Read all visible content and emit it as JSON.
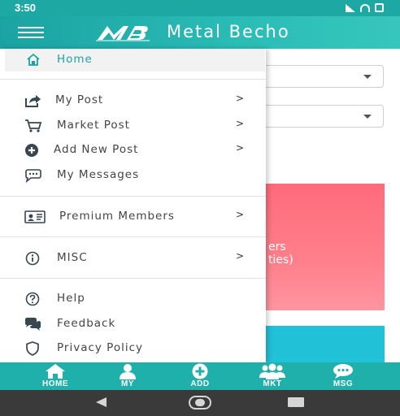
{
  "status": {
    "time": "3:50"
  },
  "app": {
    "title": "Metal Becho",
    "logo_text": "MB",
    "accent": "#1aa3a2"
  },
  "background": {
    "card_text_1": "ers",
    "card_text_2": "ties)"
  },
  "drawer": {
    "home": "Home",
    "my_post": "My Post",
    "market_post": "Market Post",
    "add_new_post": "Add New Post",
    "my_messages": "My Messages",
    "premium_members": "Premium Members",
    "misc": "MISC",
    "help": "Help",
    "feedback": "Feedback",
    "privacy_policy": "Privacy Policy",
    "chevron": ">"
  },
  "bottom_nav": {
    "home": "HOME",
    "my": "MY",
    "add": "ADD",
    "mkt": "MKT",
    "msg": "MSG"
  }
}
